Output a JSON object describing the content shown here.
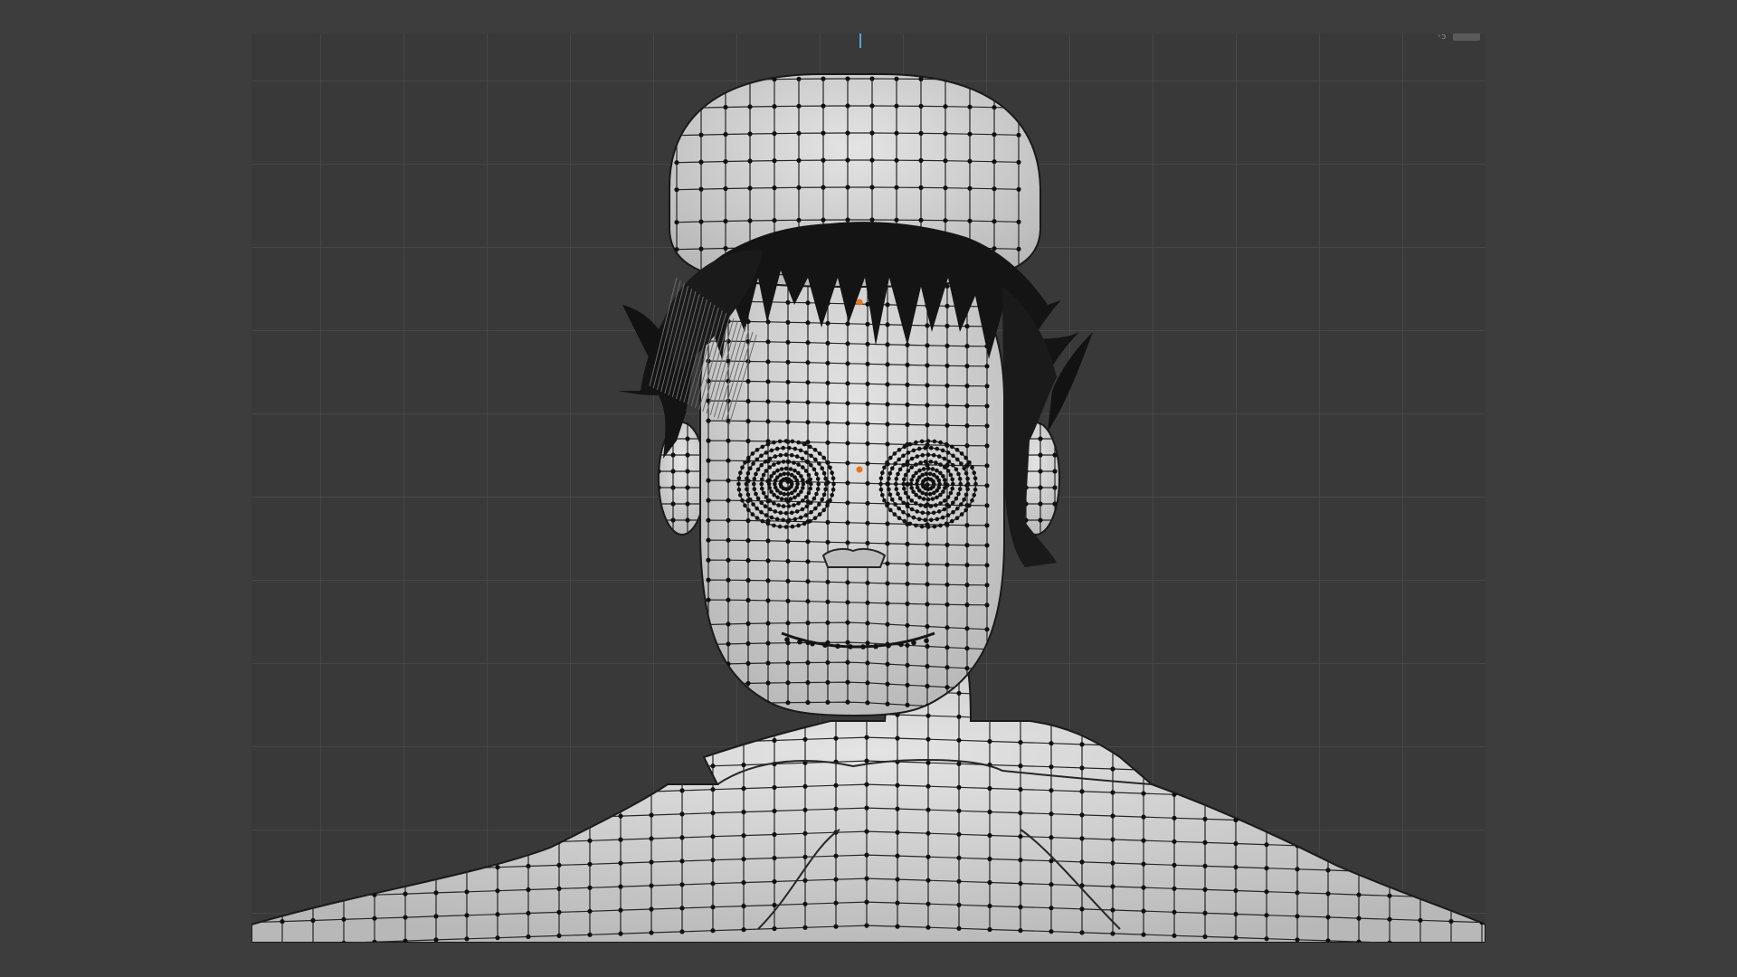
{
  "app": "3D viewport",
  "viewport": {
    "mode": "edit-mode",
    "view": "front-orthographic",
    "overlay": "wireframe-with-vertices",
    "grid": true
  },
  "colors": {
    "page_background": "#3d3d3d",
    "viewport_background": "#393939",
    "grid_line": "#4a4a4a",
    "mesh_fill": "#cfcfcf",
    "wire": "#262626",
    "vertex": "#111111",
    "hair": "#141414",
    "selected_vertex": "#e8731a",
    "z_axis": "#5aa0e6"
  },
  "icons": {
    "corner": "viewport-options-icon"
  }
}
